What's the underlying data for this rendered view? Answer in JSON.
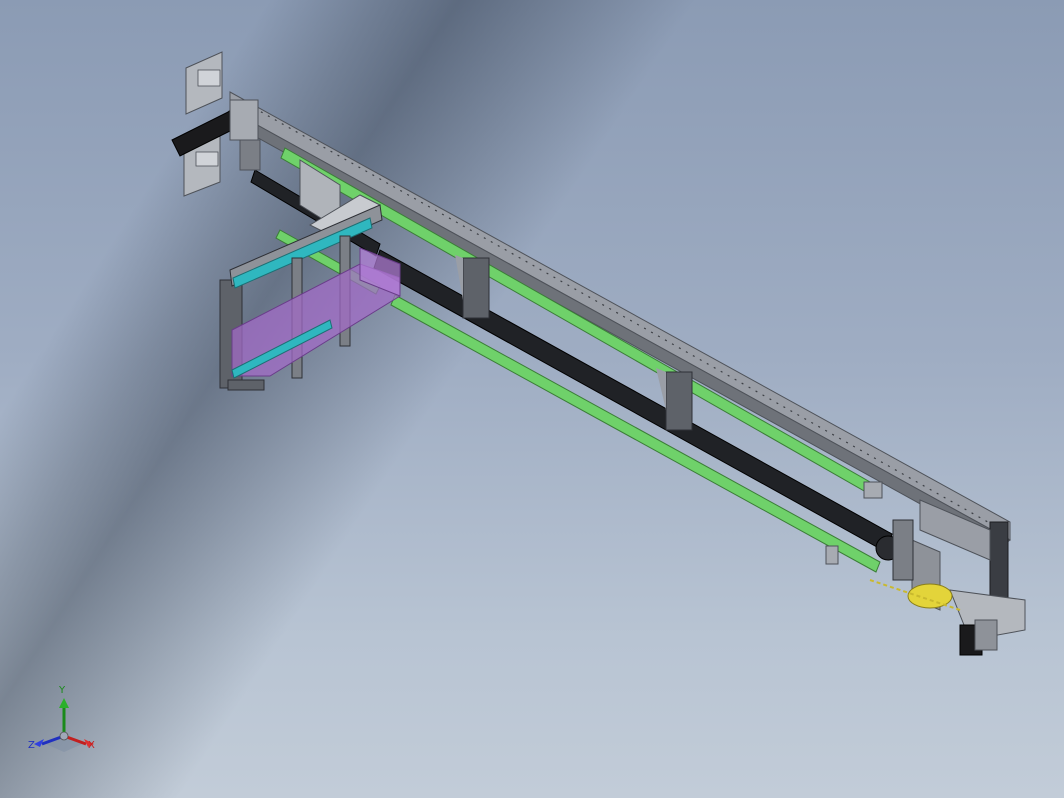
{
  "viewport": {
    "background_top": "#8b9bb4",
    "background_bottom": "#c2ccd8"
  },
  "model": {
    "colors": {
      "frame": "#8e9299",
      "frame_dark": "#4e5259",
      "rail_green": "#6fd16a",
      "belt": "#202226",
      "carriage_purple": "#a36bc9",
      "cyan_plate": "#2fb7bf",
      "yellow_part": "#e3d43a",
      "motor_black": "#1a1a1c"
    }
  },
  "triad": {
    "x_label": "X",
    "y_label": "Y",
    "z_label": "Z",
    "x_color": "#c22020",
    "y_color": "#1a8a1a",
    "z_color": "#2030c0"
  }
}
